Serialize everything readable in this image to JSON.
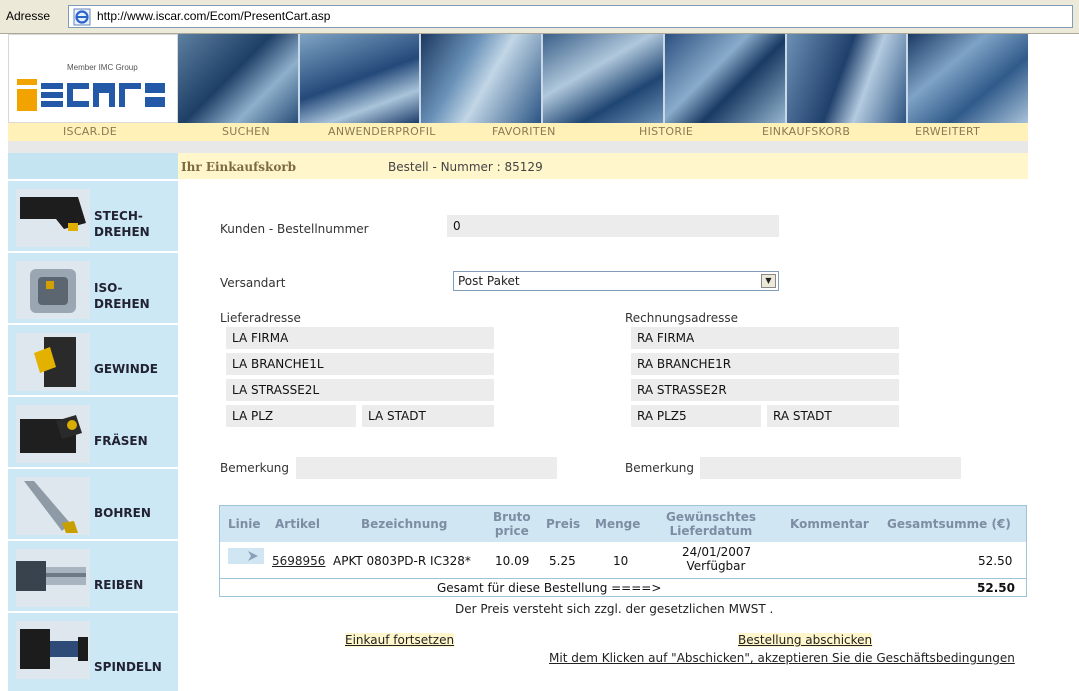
{
  "address_bar": {
    "label": "Adresse",
    "url": "http://www.iscar.com/Ecom/PresentCart.asp"
  },
  "logo": {
    "member_text": "Member IMC Group"
  },
  "nav": [
    "ISCAR.DE",
    "SUCHEN",
    "ANWENDERPROFIL",
    "FAVORITEN",
    "HISTORIE",
    "EINKAUFSKORB",
    "ERWEITERT"
  ],
  "sidebar": {
    "items": [
      {
        "label": "STECH-\nDREHEN",
        "icon": "grooving-tool-icon"
      },
      {
        "label": "ISO-\nDREHEN",
        "icon": "turning-tool-icon"
      },
      {
        "label": "GEWINDE",
        "icon": "threading-tool-icon"
      },
      {
        "label": "FRÄSEN",
        "icon": "milling-tool-icon"
      },
      {
        "label": "BOHREN",
        "icon": "drill-icon"
      },
      {
        "label": "REIBEN",
        "icon": "reamer-icon"
      },
      {
        "label": "SPINDELN",
        "icon": "spindle-icon"
      }
    ]
  },
  "cart": {
    "title": "Ihr Einkaufskorb",
    "order_number": "Bestell - Nummer : 85129"
  },
  "form": {
    "customer_order_label": "Kunden - Bestellnummer",
    "customer_order_value": "0",
    "shipping_label": "Versandart",
    "shipping_value": "Post Paket",
    "delivery_label": "Lieferadresse",
    "billing_label": "Rechnungsadresse",
    "delivery": {
      "line1": "LA FIRMA",
      "line2": "LA BRANCHE1L",
      "line3": "LA STRASSE2L",
      "plz": "LA PLZ",
      "city": "LA STADT"
    },
    "billing": {
      "line1": "RA FIRMA",
      "line2": "RA BRANCHE1R",
      "line3": "RA STRASSE2R",
      "plz": "RA PLZ5",
      "city": "RA STADT"
    },
    "remark_label": "Bemerkung",
    "remark_label2": "Bemerkung"
  },
  "table": {
    "headers": {
      "line": "Linie",
      "article": "Artikel",
      "description": "Bezeichnung",
      "gross_1": "Bruto",
      "gross_2": "price",
      "price": "Preis",
      "qty": "Menge",
      "date_1": "Gewünschtes",
      "date_2": "Lieferdatum",
      "comment": "Kommentar",
      "total": "Gesamtsumme (€)"
    },
    "rows": [
      {
        "article": "5698956",
        "description": "APKT 0803PD-R IC328*",
        "gross": "10.09",
        "price": "5.25",
        "qty": "10",
        "date": "24/01/2007",
        "availability": "Verfügbar",
        "total": "52.50"
      }
    ],
    "total_label": "Gesamt für diese Bestellung ====>",
    "total_value": "52.50"
  },
  "notes": {
    "vat": "Der Preis versteht sich zzgl. der gesetzlichen MWST .",
    "continue": "Einkauf fortsetzen",
    "submit": "Bestellung abschicken",
    "terms": "Mit dem Klicken auf \"Abschicken\", akzeptieren Sie die Geschäftsbedingungen"
  },
  "colors": {
    "nav_bg": "#fff1b8",
    "sidebar_bg": "#cce8f4",
    "table_head_bg": "#d0e6f2"
  }
}
